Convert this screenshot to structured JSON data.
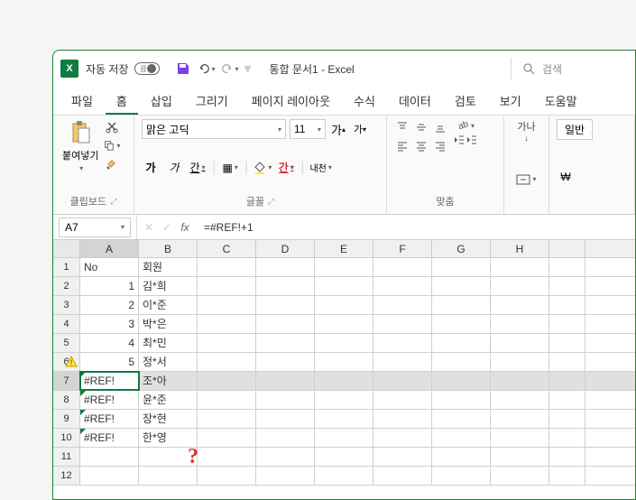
{
  "titlebar": {
    "autosave_label": "자동 저장",
    "autosave_state": "끔",
    "doc_title": "통합 문서1 - Excel",
    "search_placeholder": "검색"
  },
  "tabs": {
    "items": [
      "파일",
      "홈",
      "삽입",
      "그리기",
      "페이지 레이아웃",
      "수식",
      "데이터",
      "검토",
      "보기",
      "도움말"
    ],
    "active_index": 1
  },
  "ribbon": {
    "clipboard": {
      "paste_label": "붙여넣기",
      "group_label": "클립보드"
    },
    "font": {
      "family": "맑은 고딕",
      "size": "11",
      "bold": "가",
      "italic": "가",
      "underline": "간",
      "border_icon": "▦",
      "fill_icon": "◇",
      "color_label": "간",
      "ruby": "내천",
      "grow": "가",
      "shrink": "가",
      "group_label": "글꼴"
    },
    "align": {
      "wrap": "가나",
      "group_label": "맞춤"
    },
    "number": {
      "general": "일반",
      "currency": "₩"
    }
  },
  "formula_bar": {
    "name_box": "A7",
    "formula": "=#REF!+1"
  },
  "grid": {
    "columns": [
      "A",
      "B",
      "C",
      "D",
      "E",
      "F",
      "G",
      "H"
    ],
    "rows": [
      {
        "n": 1,
        "A": "No",
        "B": "회원"
      },
      {
        "n": 2,
        "A": "1",
        "B": "김*희"
      },
      {
        "n": 3,
        "A": "2",
        "B": "이*준"
      },
      {
        "n": 4,
        "A": "3",
        "B": "박*은"
      },
      {
        "n": 5,
        "A": "4",
        "B": "최*민"
      },
      {
        "n": 6,
        "A": "5",
        "B": "정*서",
        "warn": true
      },
      {
        "n": 7,
        "A": "#REF!",
        "B": "조*아",
        "err": true,
        "selected": true,
        "active": true
      },
      {
        "n": 8,
        "A": "#REF!",
        "B": "윤*준",
        "err": true
      },
      {
        "n": 9,
        "A": "#REF!",
        "B": "장*현",
        "err": true
      },
      {
        "n": 10,
        "A": "#REF!",
        "B": "한*영",
        "err": true
      },
      {
        "n": 11,
        "A": "",
        "B": ""
      },
      {
        "n": 12,
        "A": "",
        "B": ""
      }
    ]
  },
  "annotation": {
    "question": "?"
  }
}
